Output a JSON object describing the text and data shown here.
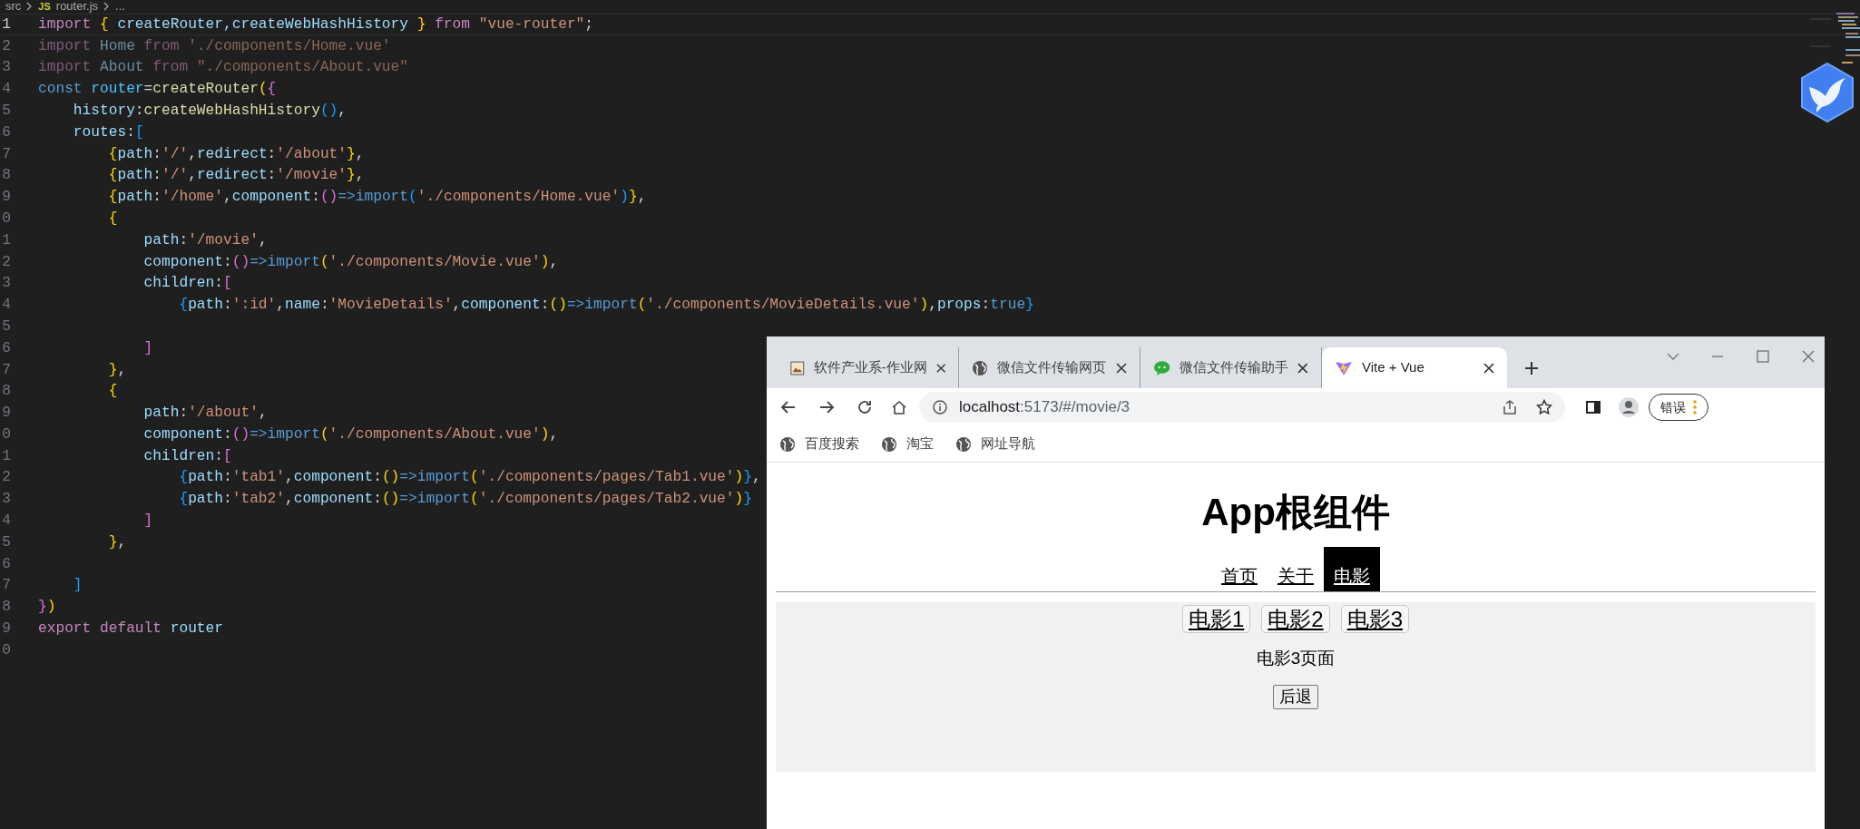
{
  "editor": {
    "breadcrumb": {
      "folder": "src",
      "file_badge": "JS",
      "file": "router.js",
      "more": "..."
    },
    "lines": [
      {
        "number": "1",
        "current": true,
        "faded": false,
        "tokens": [
          {
            "text": "import ",
            "kind": "k"
          },
          {
            "text": "{",
            "kind": "y"
          },
          {
            "text": " createRouter,createWebHashHistory ",
            "kind": "v"
          },
          {
            "text": "}",
            "kind": "y"
          },
          {
            "text": " from ",
            "kind": "k"
          },
          {
            "text": "\"vue-router\"",
            "kind": "s"
          },
          {
            "text": ";",
            "kind": "p"
          }
        ]
      },
      {
        "number": "2",
        "current": false,
        "faded": true,
        "tokens": [
          {
            "text": "import ",
            "kind": "k"
          },
          {
            "text": "Home ",
            "kind": "v"
          },
          {
            "text": "from ",
            "kind": "k"
          },
          {
            "text": "'./components/Home.vue'",
            "kind": "s"
          }
        ]
      },
      {
        "number": "3",
        "current": false,
        "faded": true,
        "tokens": [
          {
            "text": "import ",
            "kind": "k"
          },
          {
            "text": "About ",
            "kind": "v"
          },
          {
            "text": "from ",
            "kind": "k"
          },
          {
            "text": "\"./components/About.vue\"",
            "kind": "s"
          }
        ]
      },
      {
        "number": "4",
        "current": false,
        "faded": false,
        "tokens": [
          {
            "text": "const ",
            "kind": "c"
          },
          {
            "text": "router",
            "kind": "n"
          },
          {
            "text": "=",
            "kind": "p"
          },
          {
            "text": "createRouter",
            "kind": "f"
          },
          {
            "text": "(",
            "kind": "y"
          },
          {
            "text": "{",
            "kind": "m"
          }
        ]
      },
      {
        "number": "5",
        "current": false,
        "faded": false,
        "tokens": [
          {
            "text": "    history",
            "kind": "v"
          },
          {
            "text": ":",
            "kind": "p"
          },
          {
            "text": "createWebHashHistory",
            "kind": "f"
          },
          {
            "text": "()",
            "kind": "b"
          },
          {
            "text": ",",
            "kind": "p"
          }
        ]
      },
      {
        "number": "6",
        "current": false,
        "faded": false,
        "tokens": [
          {
            "text": "    routes",
            "kind": "v"
          },
          {
            "text": ":",
            "kind": "p"
          },
          {
            "text": "[",
            "kind": "b"
          }
        ]
      },
      {
        "number": "7",
        "current": false,
        "faded": false,
        "tokens": [
          {
            "text": "        {",
            "kind": "y"
          },
          {
            "text": "path",
            "kind": "v"
          },
          {
            "text": ":",
            "kind": "p"
          },
          {
            "text": "'/'",
            "kind": "s"
          },
          {
            "text": ",",
            "kind": "p"
          },
          {
            "text": "redirect",
            "kind": "v"
          },
          {
            "text": ":",
            "kind": "p"
          },
          {
            "text": "'/about'",
            "kind": "s"
          },
          {
            "text": "}",
            "kind": "y"
          },
          {
            "text": ",",
            "kind": "p"
          }
        ]
      },
      {
        "number": "8",
        "current": false,
        "faded": false,
        "tokens": [
          {
            "text": "        {",
            "kind": "y"
          },
          {
            "text": "path",
            "kind": "v"
          },
          {
            "text": ":",
            "kind": "p"
          },
          {
            "text": "'/'",
            "kind": "s"
          },
          {
            "text": ",",
            "kind": "p"
          },
          {
            "text": "redirect",
            "kind": "v"
          },
          {
            "text": ":",
            "kind": "p"
          },
          {
            "text": "'/movie'",
            "kind": "s"
          },
          {
            "text": "}",
            "kind": "y"
          },
          {
            "text": ",",
            "kind": "p"
          }
        ]
      },
      {
        "number": "9",
        "current": false,
        "faded": false,
        "tokens": [
          {
            "text": "        {",
            "kind": "y"
          },
          {
            "text": "path",
            "kind": "v"
          },
          {
            "text": ":",
            "kind": "p"
          },
          {
            "text": "'/home'",
            "kind": "s"
          },
          {
            "text": ",",
            "kind": "p"
          },
          {
            "text": "component",
            "kind": "v"
          },
          {
            "text": ":",
            "kind": "p"
          },
          {
            "text": "()",
            "kind": "m"
          },
          {
            "text": "=>",
            "kind": "c"
          },
          {
            "text": "import",
            "kind": "c"
          },
          {
            "text": "(",
            "kind": "b"
          },
          {
            "text": "'./components/Home.vue'",
            "kind": "s"
          },
          {
            "text": ")",
            "kind": "b"
          },
          {
            "text": "}",
            "kind": "y"
          },
          {
            "text": ",",
            "kind": "p"
          }
        ]
      },
      {
        "number": "0",
        "current": false,
        "faded": false,
        "tokens": [
          {
            "text": "        {",
            "kind": "y"
          }
        ]
      },
      {
        "number": "1",
        "current": false,
        "faded": false,
        "tokens": [
          {
            "text": "            path",
            "kind": "v"
          },
          {
            "text": ":",
            "kind": "p"
          },
          {
            "text": "'/movie'",
            "kind": "s"
          },
          {
            "text": ",",
            "kind": "p"
          }
        ]
      },
      {
        "number": "2",
        "current": false,
        "faded": false,
        "tokens": [
          {
            "text": "            component",
            "kind": "v"
          },
          {
            "text": ":",
            "kind": "p"
          },
          {
            "text": "()",
            "kind": "m"
          },
          {
            "text": "=>",
            "kind": "c"
          },
          {
            "text": "import",
            "kind": "c"
          },
          {
            "text": "(",
            "kind": "y"
          },
          {
            "text": "'./components/Movie.vue'",
            "kind": "s"
          },
          {
            "text": ")",
            "kind": "y"
          },
          {
            "text": ",",
            "kind": "p"
          }
        ]
      },
      {
        "number": "3",
        "current": false,
        "faded": false,
        "tokens": [
          {
            "text": "            children",
            "kind": "v"
          },
          {
            "text": ":",
            "kind": "p"
          },
          {
            "text": "[",
            "kind": "m"
          }
        ]
      },
      {
        "number": "4",
        "current": false,
        "faded": false,
        "tokens": [
          {
            "text": "                {",
            "kind": "b"
          },
          {
            "text": "path",
            "kind": "v"
          },
          {
            "text": ":",
            "kind": "p"
          },
          {
            "text": "':id'",
            "kind": "s"
          },
          {
            "text": ",",
            "kind": "p"
          },
          {
            "text": "name",
            "kind": "v"
          },
          {
            "text": ":",
            "kind": "p"
          },
          {
            "text": "'MovieDetails'",
            "kind": "s"
          },
          {
            "text": ",",
            "kind": "p"
          },
          {
            "text": "component",
            "kind": "v"
          },
          {
            "text": ":",
            "kind": "p"
          },
          {
            "text": "()",
            "kind": "y"
          },
          {
            "text": "=>",
            "kind": "c"
          },
          {
            "text": "import",
            "kind": "c"
          },
          {
            "text": "(",
            "kind": "y"
          },
          {
            "text": "'./components/MovieDetails.vue'",
            "kind": "s"
          },
          {
            "text": ")",
            "kind": "y"
          },
          {
            "text": ",",
            "kind": "p"
          },
          {
            "text": "props",
            "kind": "v"
          },
          {
            "text": ":",
            "kind": "p"
          },
          {
            "text": "true",
            "kind": "c"
          },
          {
            "text": "}",
            "kind": "b"
          }
        ]
      },
      {
        "number": "5",
        "current": false
      },
      {
        "number": "6",
        "current": false,
        "faded": false,
        "tokens": [
          {
            "text": "            ]",
            "kind": "m"
          }
        ]
      },
      {
        "number": "7",
        "current": false,
        "faded": false,
        "tokens": [
          {
            "text": "        }",
            "kind": "y"
          },
          {
            "text": ",",
            "kind": "p"
          }
        ]
      },
      {
        "number": "8",
        "current": false,
        "faded": false,
        "tokens": [
          {
            "text": "        {",
            "kind": "y"
          }
        ]
      },
      {
        "number": "9",
        "current": false,
        "faded": false,
        "tokens": [
          {
            "text": "            path",
            "kind": "v"
          },
          {
            "text": ":",
            "kind": "p"
          },
          {
            "text": "'/about'",
            "kind": "s"
          },
          {
            "text": ",",
            "kind": "p"
          }
        ]
      },
      {
        "number": "0",
        "current": false,
        "faded": false,
        "tokens": [
          {
            "text": "            component",
            "kind": "v"
          },
          {
            "text": ":",
            "kind": "p"
          },
          {
            "text": "()",
            "kind": "m"
          },
          {
            "text": "=>",
            "kind": "c"
          },
          {
            "text": "import",
            "kind": "c"
          },
          {
            "text": "(",
            "kind": "y"
          },
          {
            "text": "'./components/About.vue'",
            "kind": "s"
          },
          {
            "text": ")",
            "kind": "y"
          },
          {
            "text": ",",
            "kind": "p"
          }
        ]
      },
      {
        "number": "1",
        "current": false,
        "faded": false,
        "tokens": [
          {
            "text": "            children",
            "kind": "v"
          },
          {
            "text": ":",
            "kind": "p"
          },
          {
            "text": "[",
            "kind": "m"
          }
        ]
      },
      {
        "number": "2",
        "current": false,
        "faded": false,
        "tokens": [
          {
            "text": "                {",
            "kind": "b"
          },
          {
            "text": "path",
            "kind": "v"
          },
          {
            "text": ":",
            "kind": "p"
          },
          {
            "text": "'tab1'",
            "kind": "s"
          },
          {
            "text": ",",
            "kind": "p"
          },
          {
            "text": "component",
            "kind": "v"
          },
          {
            "text": ":",
            "kind": "p"
          },
          {
            "text": "()",
            "kind": "y"
          },
          {
            "text": "=>",
            "kind": "c"
          },
          {
            "text": "import",
            "kind": "c"
          },
          {
            "text": "(",
            "kind": "y"
          },
          {
            "text": "'./components/pages/Tab1.vue'",
            "kind": "s"
          },
          {
            "text": ")",
            "kind": "y"
          },
          {
            "text": "}",
            "kind": "b"
          },
          {
            "text": ",",
            "kind": "p"
          }
        ]
      },
      {
        "number": "3",
        "current": false,
        "faded": false,
        "tokens": [
          {
            "text": "                {",
            "kind": "b"
          },
          {
            "text": "path",
            "kind": "v"
          },
          {
            "text": ":",
            "kind": "p"
          },
          {
            "text": "'tab2'",
            "kind": "s"
          },
          {
            "text": ",",
            "kind": "p"
          },
          {
            "text": "component",
            "kind": "v"
          },
          {
            "text": ":",
            "kind": "p"
          },
          {
            "text": "()",
            "kind": "y"
          },
          {
            "text": "=>",
            "kind": "c"
          },
          {
            "text": "import",
            "kind": "c"
          },
          {
            "text": "(",
            "kind": "y"
          },
          {
            "text": "'./components/pages/Tab2.vue'",
            "kind": "s"
          },
          {
            "text": ")",
            "kind": "y"
          },
          {
            "text": "}",
            "kind": "b"
          }
        ]
      },
      {
        "number": "4",
        "current": false,
        "faded": false,
        "tokens": [
          {
            "text": "            ]",
            "kind": "m"
          }
        ]
      },
      {
        "number": "5",
        "current": false,
        "faded": false,
        "tokens": [
          {
            "text": "        }",
            "kind": "y"
          },
          {
            "text": ",",
            "kind": "p"
          }
        ]
      },
      {
        "number": "6",
        "current": false
      },
      {
        "number": "7",
        "current": false,
        "faded": false,
        "tokens": [
          {
            "text": "    ]",
            "kind": "b"
          }
        ]
      },
      {
        "number": "8",
        "current": false,
        "faded": false,
        "tokens": [
          {
            "text": "}",
            "kind": "m"
          },
          {
            "text": ")",
            "kind": "y"
          }
        ]
      },
      {
        "number": "9",
        "current": false,
        "faded": false,
        "tokens": [
          {
            "text": "export ",
            "kind": "k"
          },
          {
            "text": "default ",
            "kind": "k"
          },
          {
            "text": "router",
            "kind": "v"
          }
        ]
      },
      {
        "number": "0",
        "current": false
      }
    ]
  },
  "browser": {
    "tabs": [
      {
        "title": "软件产业系-作业网",
        "kind": "thumb",
        "selected": false
      },
      {
        "title": "微信文件传输网页",
        "kind": "globe",
        "selected": false
      },
      {
        "title": "微信文件传输助手",
        "kind": "chat",
        "selected": false
      },
      {
        "title": "Vite + Vue",
        "kind": "vite",
        "selected": true
      }
    ],
    "address": {
      "host": "localhost",
      "rest": ":5173/#/movie/3"
    },
    "profile_label": "错误",
    "bookmarks": [
      "百度搜索",
      "淘宝",
      "网址导航"
    ],
    "page": {
      "heading": "App根组件",
      "nav": [
        {
          "label": "首页",
          "selected": false
        },
        {
          "label": "关于",
          "selected": false
        },
        {
          "label": "电影",
          "selected": true
        }
      ],
      "movie_links": [
        "电影1",
        "电影2",
        "电影3"
      ],
      "content": "电影3页面",
      "back_button": "后退"
    }
  }
}
